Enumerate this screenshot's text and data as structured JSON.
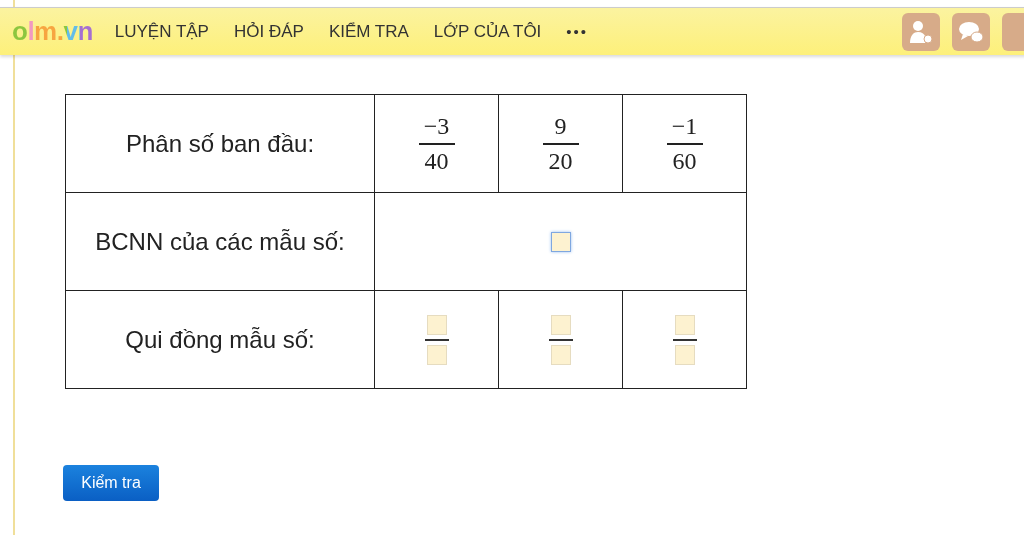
{
  "header": {
    "logo": "olm.vn",
    "nav": [
      "LUYỆN TẬP",
      "HỎI ĐÁP",
      "KIỂM TRA",
      "LỚP CỦA TÔI"
    ],
    "more": "•••"
  },
  "table": {
    "rows": [
      {
        "kind": "fractions",
        "label": "Phân số ban đầu:",
        "fractions": [
          {
            "numerator": "−3",
            "denominator": "40"
          },
          {
            "numerator": "9",
            "denominator": "20"
          },
          {
            "numerator": "−1",
            "denominator": "60"
          }
        ]
      },
      {
        "kind": "single",
        "label": "BCNN của các mẫu số:",
        "field": {
          "focused": true
        }
      },
      {
        "kind": "inputs",
        "label": "Qui đồng mẫu số:",
        "fields": [
          {
            "focused": false
          },
          {
            "focused": false
          },
          {
            "focused": false
          }
        ]
      }
    ]
  },
  "submit_button": "Kiểm tra"
}
